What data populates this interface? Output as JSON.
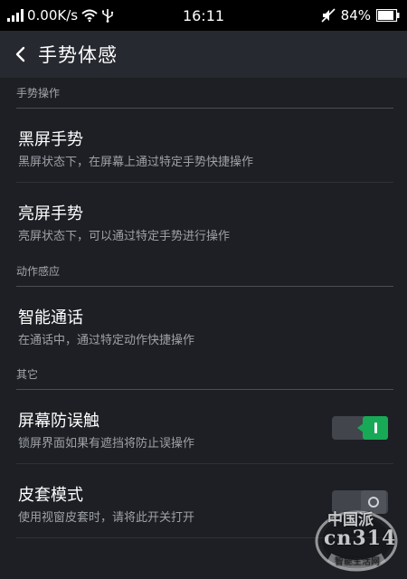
{
  "status_bar": {
    "network_speed": "0.00K/s",
    "time": "16:11",
    "battery": "84%",
    "icons": [
      "signal-icon",
      "wifi-icon",
      "usb-icon",
      "mute-icon",
      "battery-icon"
    ]
  },
  "header": {
    "title": "手势体感",
    "back_icon": "chevron-left-icon"
  },
  "sections": [
    {
      "title": "手势操作",
      "items": [
        {
          "title": "黑屏手势",
          "desc": "黑屏状态下，在屏幕上通过特定手势快捷操作"
        },
        {
          "title": "亮屏手势",
          "desc": "亮屏状态下，可以通过特定手势进行操作"
        }
      ]
    },
    {
      "title": "动作感应",
      "items": [
        {
          "title": "智能通话",
          "desc": "在通话中，通过特定动作快捷操作"
        }
      ]
    },
    {
      "title": "其它",
      "items": [
        {
          "title": "屏幕防误触",
          "desc": "锁屏界面如果有遮挡将防止误操作",
          "toggle": "on"
        },
        {
          "title": "皮套模式",
          "desc": "使用视窗皮套时，请将此开关打开",
          "toggle": "off"
        }
      ]
    }
  ],
  "watermark": {
    "line1": "中国派",
    "line2": "cn314",
    "line3": "智能生活网"
  },
  "colors": {
    "background": "#1d1f24",
    "header": "#262930",
    "toggle_on": "#18a957",
    "toggle_off": "#42454c"
  }
}
